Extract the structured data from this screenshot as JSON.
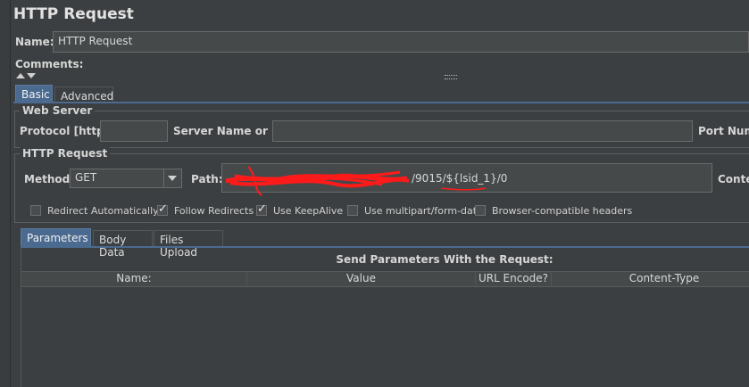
{
  "title": "HTTP Request",
  "name_label": "Name:",
  "name_value": "HTTP Request",
  "comments_label": "Comments:",
  "tabs": [
    {
      "label": "Basic",
      "active": true
    },
    {
      "label": "Advanced",
      "active": false
    }
  ],
  "web_server": {
    "legend": "Web Server",
    "protocol_label": "Protocol [http]:",
    "protocol_value": "",
    "server_label": "Server Name or IP:",
    "server_value": "",
    "port_label": "Port Numb"
  },
  "http_request": {
    "legend": "HTTP Request",
    "method_label": "Method:",
    "method_value": "GET",
    "path_label": "Path:",
    "path_value": "/9015/${lsid_1}/0",
    "content_label": "Conter"
  },
  "checkboxes": [
    {
      "label": "Redirect Automatically",
      "checked": false
    },
    {
      "label": "Follow Redirects",
      "checked": true
    },
    {
      "label": "Use KeepAlive",
      "checked": true
    },
    {
      "label": "Use multipart/form-data",
      "checked": false
    },
    {
      "label": "Browser-compatible headers",
      "checked": false
    }
  ],
  "subtabs": [
    {
      "label": "Parameters",
      "active": true
    },
    {
      "label": "Body Data",
      "active": false
    },
    {
      "label": "Files Upload",
      "active": false
    }
  ],
  "params": {
    "caption": "Send Parameters With the Request:",
    "columns": [
      "Name:",
      "Value",
      "URL Encode?",
      "Content-Type"
    ]
  },
  "colors": {
    "background": "#3c3f41",
    "active_tab": "#4b6a8f",
    "redaction": "#ff1a1a"
  }
}
